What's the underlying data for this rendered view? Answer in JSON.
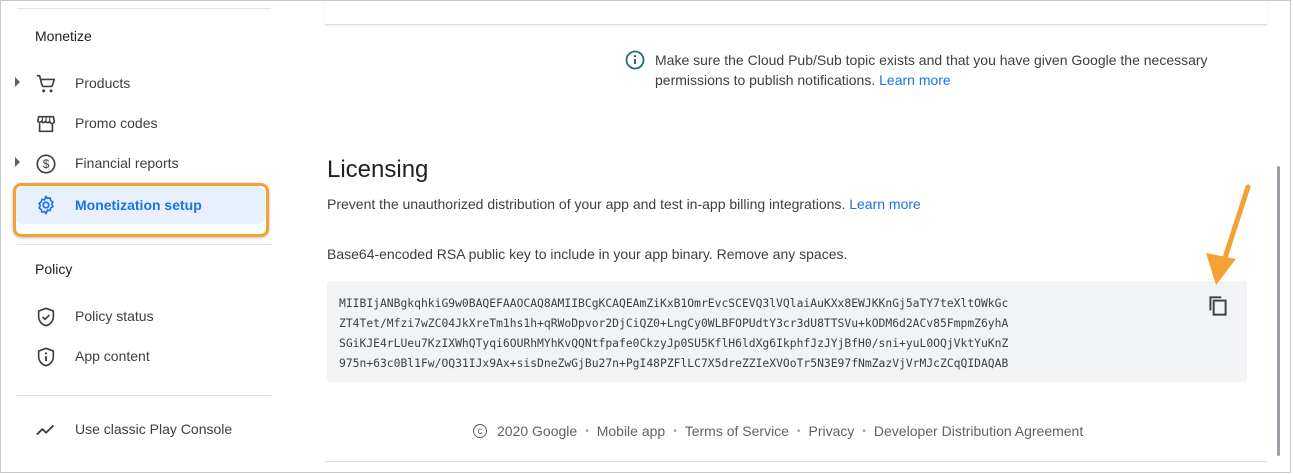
{
  "sidebar": {
    "monetize_title": "Monetize",
    "items": [
      {
        "label": "Products",
        "icon": "cart-icon"
      },
      {
        "label": "Promo codes",
        "icon": "store-icon"
      },
      {
        "label": "Financial reports",
        "icon": "dollar-icon"
      },
      {
        "label": "Monetization setup",
        "icon": "gear-icon"
      }
    ],
    "policy_title": "Policy",
    "policy_items": [
      {
        "label": "Policy status",
        "icon": "shield-icon"
      },
      {
        "label": "App content",
        "icon": "shield-info-icon"
      }
    ],
    "classic_label": "Use classic Play Console"
  },
  "info": {
    "text": "Make sure the Cloud Pub/Sub topic exists and that you have given Google the necessary permissions to publish notifications.",
    "link": "Learn more"
  },
  "licensing": {
    "title": "Licensing",
    "description": "Prevent the unauthorized distribution of your app and test in-app billing integrations.",
    "link": "Learn more",
    "key_label": "Base64-encoded RSA public key to include in your app binary. Remove any spaces.",
    "key_lines": [
      "MIIBIjANBgkqhkiG9w0BAQEFAAOCAQ8AMIIBCgKCAQEAmZiKxB1OmrEvcSCEVQ3lVQlaiAuKXx8EWJKKnGj5aTY7teXltOWkGc",
      "ZT4Tet/Mfzi7wZC04JkXreTm1hs1h+qRWoDpvor2DjCiQZ0+LngCy0WLBFOPUdtY3cr3dU8TTSVu+kODM6d2ACv85FmpmZ6yhA",
      "SGiKJE4rLUeu7KzIXWhQTyqi6OURhMYhKvQQNtfpafe0CkzyJp0SU5KflH6ldXg6IkphfJzJYjBfH0/sni+yuL0OQjVktYuKnZ",
      "975n+63c0Bl1Fw/OQ31IJx9Ax+sisDneZwGjBu27n+PgI48PZFlLC7X5dreZZIeXVOoTr5N3E97fNmZazVjVrMJcZCqQIDAQAB"
    ]
  },
  "footer": {
    "copyright_symbol": "c",
    "copyright": "2020 Google",
    "links": [
      "Mobile app",
      "Terms of Service",
      "Privacy",
      "Developer Distribution Agreement"
    ]
  },
  "colors": {
    "accent": "#1a73e8",
    "highlight": "#f5a234",
    "active_bg": "#e8f0fe"
  }
}
